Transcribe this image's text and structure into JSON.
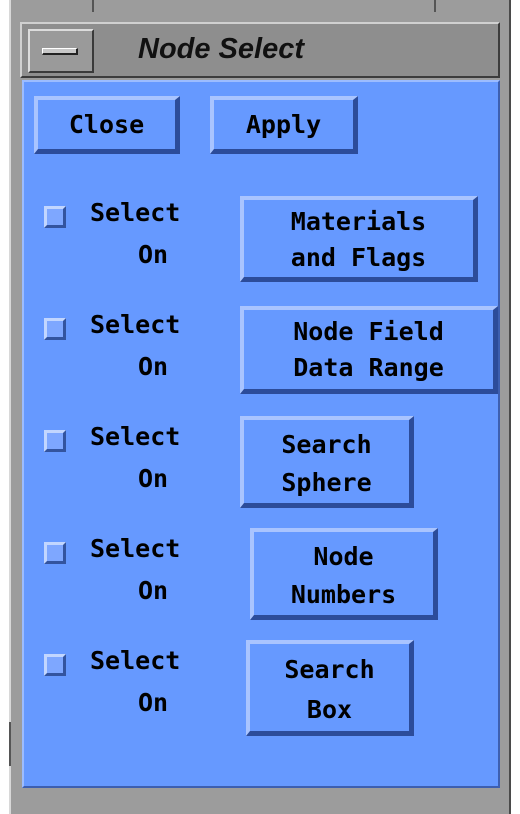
{
  "window": {
    "title": "Node Select"
  },
  "toolbar": {
    "close_label": "Close",
    "apply_label": "Apply"
  },
  "rows": [
    {
      "select_line1": "Select",
      "select_line2": "On",
      "button_line1": "Materials",
      "button_line2": "and Flags",
      "checked": false
    },
    {
      "select_line1": "Select",
      "select_line2": "On",
      "button_line1": "Node Field",
      "button_line2": "Data Range",
      "checked": false
    },
    {
      "select_line1": "Select",
      "select_line2": "On",
      "button_line1": "Search",
      "button_line2": "Sphere",
      "checked": false
    },
    {
      "select_line1": "Select",
      "select_line2": "On",
      "button_line1": "Node",
      "button_line2": "Numbers",
      "checked": false
    },
    {
      "select_line1": "Select",
      "select_line2": "On",
      "button_line1": "Search",
      "button_line2": "Box",
      "checked": false
    }
  ],
  "colors": {
    "panel": "#6699ff",
    "frame": "#9c9c9c"
  },
  "icons": {
    "window_menu": "window-menu-icon"
  }
}
